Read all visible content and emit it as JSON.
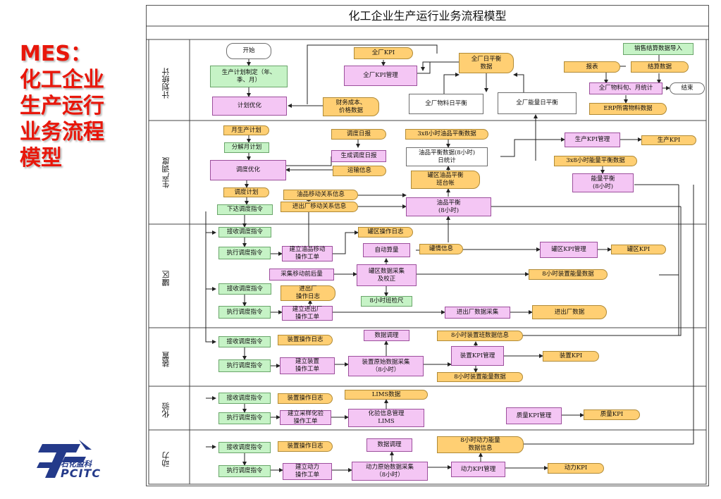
{
  "slide": {
    "title_lines": [
      "MES：",
      "化工企业",
      "生产运行",
      "业务流程",
      "模型"
    ]
  },
  "logo": {
    "cn": "石化盈科",
    "en": "PCITC"
  },
  "diagram": {
    "title": "化工企业生产运行业务流程模型",
    "lanes": [
      {
        "id": "plan",
        "label": "计划统计"
      },
      {
        "id": "dispatch",
        "label": "生产调度"
      },
      {
        "id": "tank",
        "label": "罐区"
      },
      {
        "id": "unit",
        "label": "装置"
      },
      {
        "id": "lab",
        "label": "化验"
      },
      {
        "id": "power",
        "label": "动力"
      }
    ],
    "nodes": {
      "start": "开始",
      "end": "结束",
      "plan_make": "生产计划制定（年、\n季、月）",
      "plan_opt": "计划优化",
      "fin": "财务成本、\n价格数据",
      "kpi_all": "全厂KPI",
      "kpi_mgmt": "全厂KPI管理",
      "daily_bal": "全厂日平衡\n数据",
      "mat_daily": "全厂物料日平衡",
      "energy_daily": "全厂能量日平衡",
      "sales": "销售结算数据导入",
      "report": "报表",
      "settle": "结算数据",
      "mat_stat": "全厂物料旬、月统计",
      "erp": "ERP所需物料数据",
      "month_plan": "月生产计划",
      "split_plan": "分解月计划",
      "disp_opt": "调度优化",
      "disp_plan": "调度计划",
      "issue_cmd": "下达调度指令",
      "disp_daily": "调度日报",
      "gen_daily": "生成调度日报",
      "trans": "运输信息",
      "oil_bal_3x8": "3x8小时油品平衡数据",
      "oil_bal_daily": "油品平衡数据(8小时)\n日统计",
      "tank_bal": "罐区油品平衡\n班台帐",
      "oil_move": "油品移动关系信息",
      "inout_move": "进出厂移动关系信息",
      "oil_bal": "油品平衡\n(8小时)",
      "prod_kpi_mgmt": "生产KPI管理",
      "prod_kpi": "生产KPI",
      "energy_3x8": "3x8小时能量平衡数据",
      "energy_bal": "能量平衡\n(8小时)",
      "tank_recv1": "接收调度指令",
      "tank_exec1": "执行调度指令",
      "tank_build": "建立油品移动\n操作工单",
      "tank_log": "罐区操作日志",
      "auto_gauge": "自动算量",
      "tank_info": "罐情信息",
      "tank_kpi_mgmt": "罐区KPI管理",
      "tank_kpi": "罐区KPI",
      "collect_pre": "采集移动前后量",
      "tank_collect": "罐区数据采集\n及校正",
      "unit_energy_8h": "8小时装置能量数据",
      "tank_recv2": "接收调度指令",
      "inout_log": "进出厂\n操作日志",
      "shift_check": "8小时班检尺",
      "tank_exec2": "执行调度指令",
      "inout_build": "建立进出厂\n操作工单",
      "inout_collect": "进出厂数据采集",
      "inout_data": "进出厂数据",
      "unit_recv": "接收调度指令",
      "unit_log": "装置操作日志",
      "data_adjust": "数据调理",
      "unit_shift_info": "8小时装置班数据信息",
      "unit_exec": "执行调度指令",
      "unit_build": "建立装置\n操作工单",
      "unit_collect": "装置原始数据采集\n（8小时）",
      "unit_kpi_mgmt": "装置KPI管理",
      "unit_kpi": "装置KPI",
      "unit_energy_8h2": "8小时装置能量数据",
      "lab_recv": "接收调度指令",
      "lab_log": "装置操作日志",
      "lims": "LIMS数据",
      "lab_exec": "执行调度指令",
      "lab_build": "建立采样化验\n操作工单",
      "lab_mgmt": "化验信息管理\nLIMS",
      "qual_kpi_mgmt": "质量KPI管理",
      "qual_kpi": "质量KPI",
      "pw_recv": "接收调度指令",
      "pw_log": "装置操作日志",
      "pw_adjust": "数据调理",
      "pw_energy_info": "8小时动力能量\n数据信息",
      "pw_exec": "执行调度指令",
      "pw_build": "建立动力\n操作工单",
      "pw_collect": "动力原始数据采集\n（8小时）",
      "pw_kpi_mgmt": "动力KPI管理",
      "pw_kpi": "动力KPI"
    }
  },
  "colors": {
    "title_red": "#e8170b",
    "green_box": "#c6f3c6",
    "pink_box": "#f4c6f4",
    "doc_box": "#ffcf73",
    "logo_blue": "#243a8a"
  }
}
